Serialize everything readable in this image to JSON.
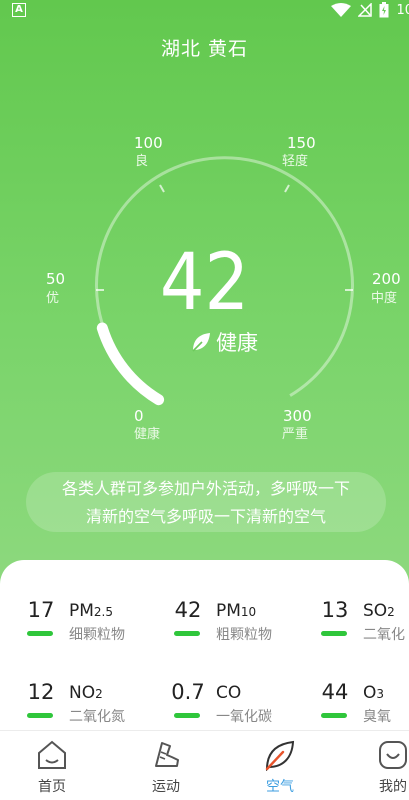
{
  "status": {
    "time": "10",
    "app_letter": "A"
  },
  "header": {
    "city": "湖北 黄石"
  },
  "gauge": {
    "ticks": [
      {
        "value": "100",
        "label": "良"
      },
      {
        "value": "150",
        "label": "轻度"
      },
      {
        "value": "50",
        "label": "优"
      },
      {
        "value": "200",
        "label": "中度"
      },
      {
        "value": "0",
        "label": "健康"
      },
      {
        "value": "300",
        "label": "严重"
      }
    ],
    "aqi": "42",
    "level": "健康",
    "progress_fraction": 0.14
  },
  "advice": {
    "line1": "各类人群可多参加户外活动，多呼吸一下",
    "line2": "清新的空气多呼吸一下清新的空气"
  },
  "pollutants": [
    {
      "value": "17",
      "name": "PM",
      "sub": "2.5",
      "cn": "细颗粒物"
    },
    {
      "value": "42",
      "name": "PM",
      "sub": "10",
      "cn": "粗颗粒物"
    },
    {
      "value": "13",
      "name": "SO",
      "sub": "2",
      "cn": "二氧化"
    },
    {
      "value": "12",
      "name": "NO",
      "sub": "2",
      "cn": "二氧化氮"
    },
    {
      "value": "0.7",
      "name": "CO",
      "sub": "",
      "cn": "一氧化碳"
    },
    {
      "value": "44",
      "name": "O",
      "sub": "3",
      "cn": "臭氧"
    }
  ],
  "tabs": [
    {
      "label": "首页",
      "icon": "home-icon"
    },
    {
      "label": "运动",
      "icon": "shoe-icon"
    },
    {
      "label": "空气",
      "icon": "leaf-icon"
    },
    {
      "label": "我的",
      "icon": "profile-icon"
    }
  ],
  "colors": {
    "accent": "#62c84e",
    "bar": "#2fc63b",
    "active_tab": "#3d9ee0"
  }
}
